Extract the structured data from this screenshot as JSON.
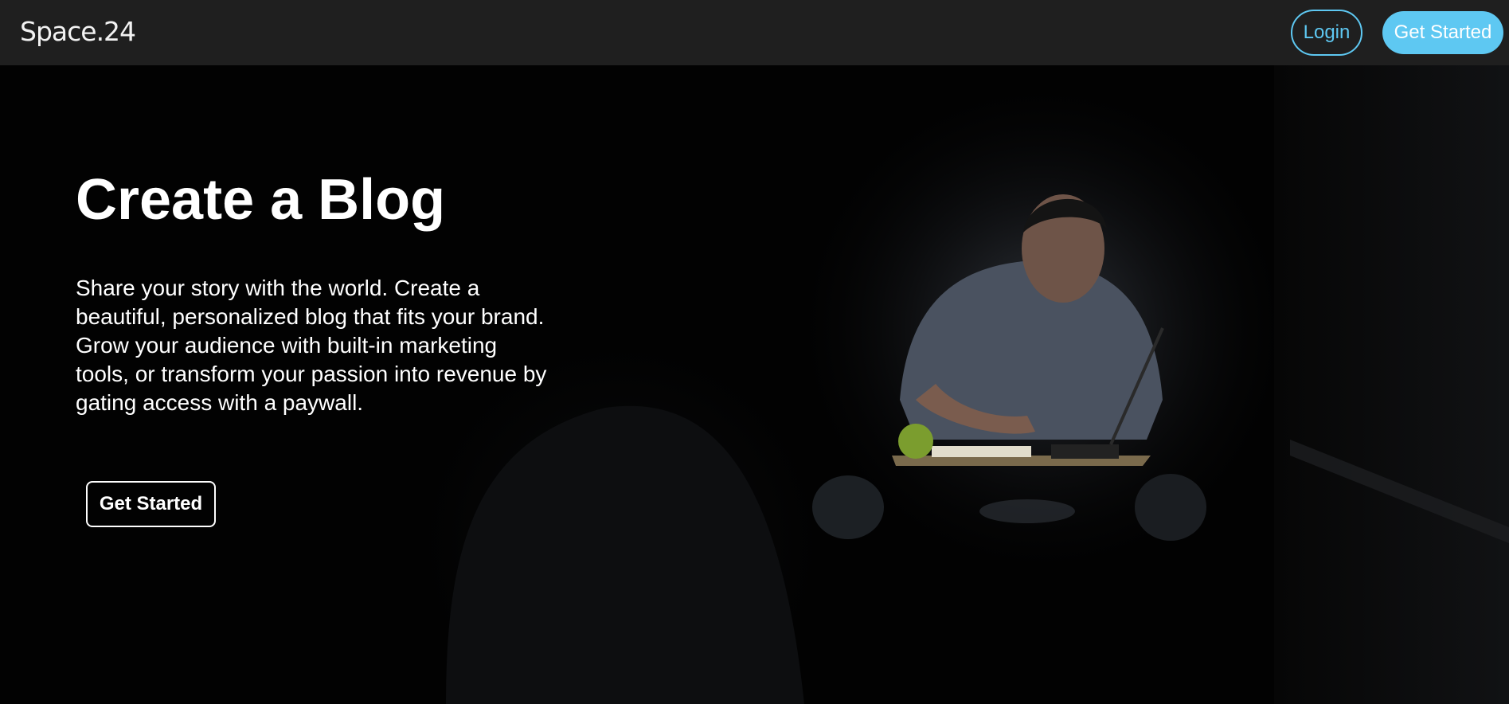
{
  "navbar": {
    "brand": "Space.24",
    "login_label": "Login",
    "get_started_label": "Get Started"
  },
  "hero": {
    "title": "Create a Blog",
    "description": "Share your story with the world. Create a beautiful, personalized blog that fits your brand. Grow your audience with built-in marketing tools, or transform your passion into revenue by gating access with a paywall.",
    "button_label": "Get Started"
  },
  "colors": {
    "navbar_bg": "#1f1f1f",
    "accent": "#5ec8f2",
    "hero_bg": "#020202"
  }
}
